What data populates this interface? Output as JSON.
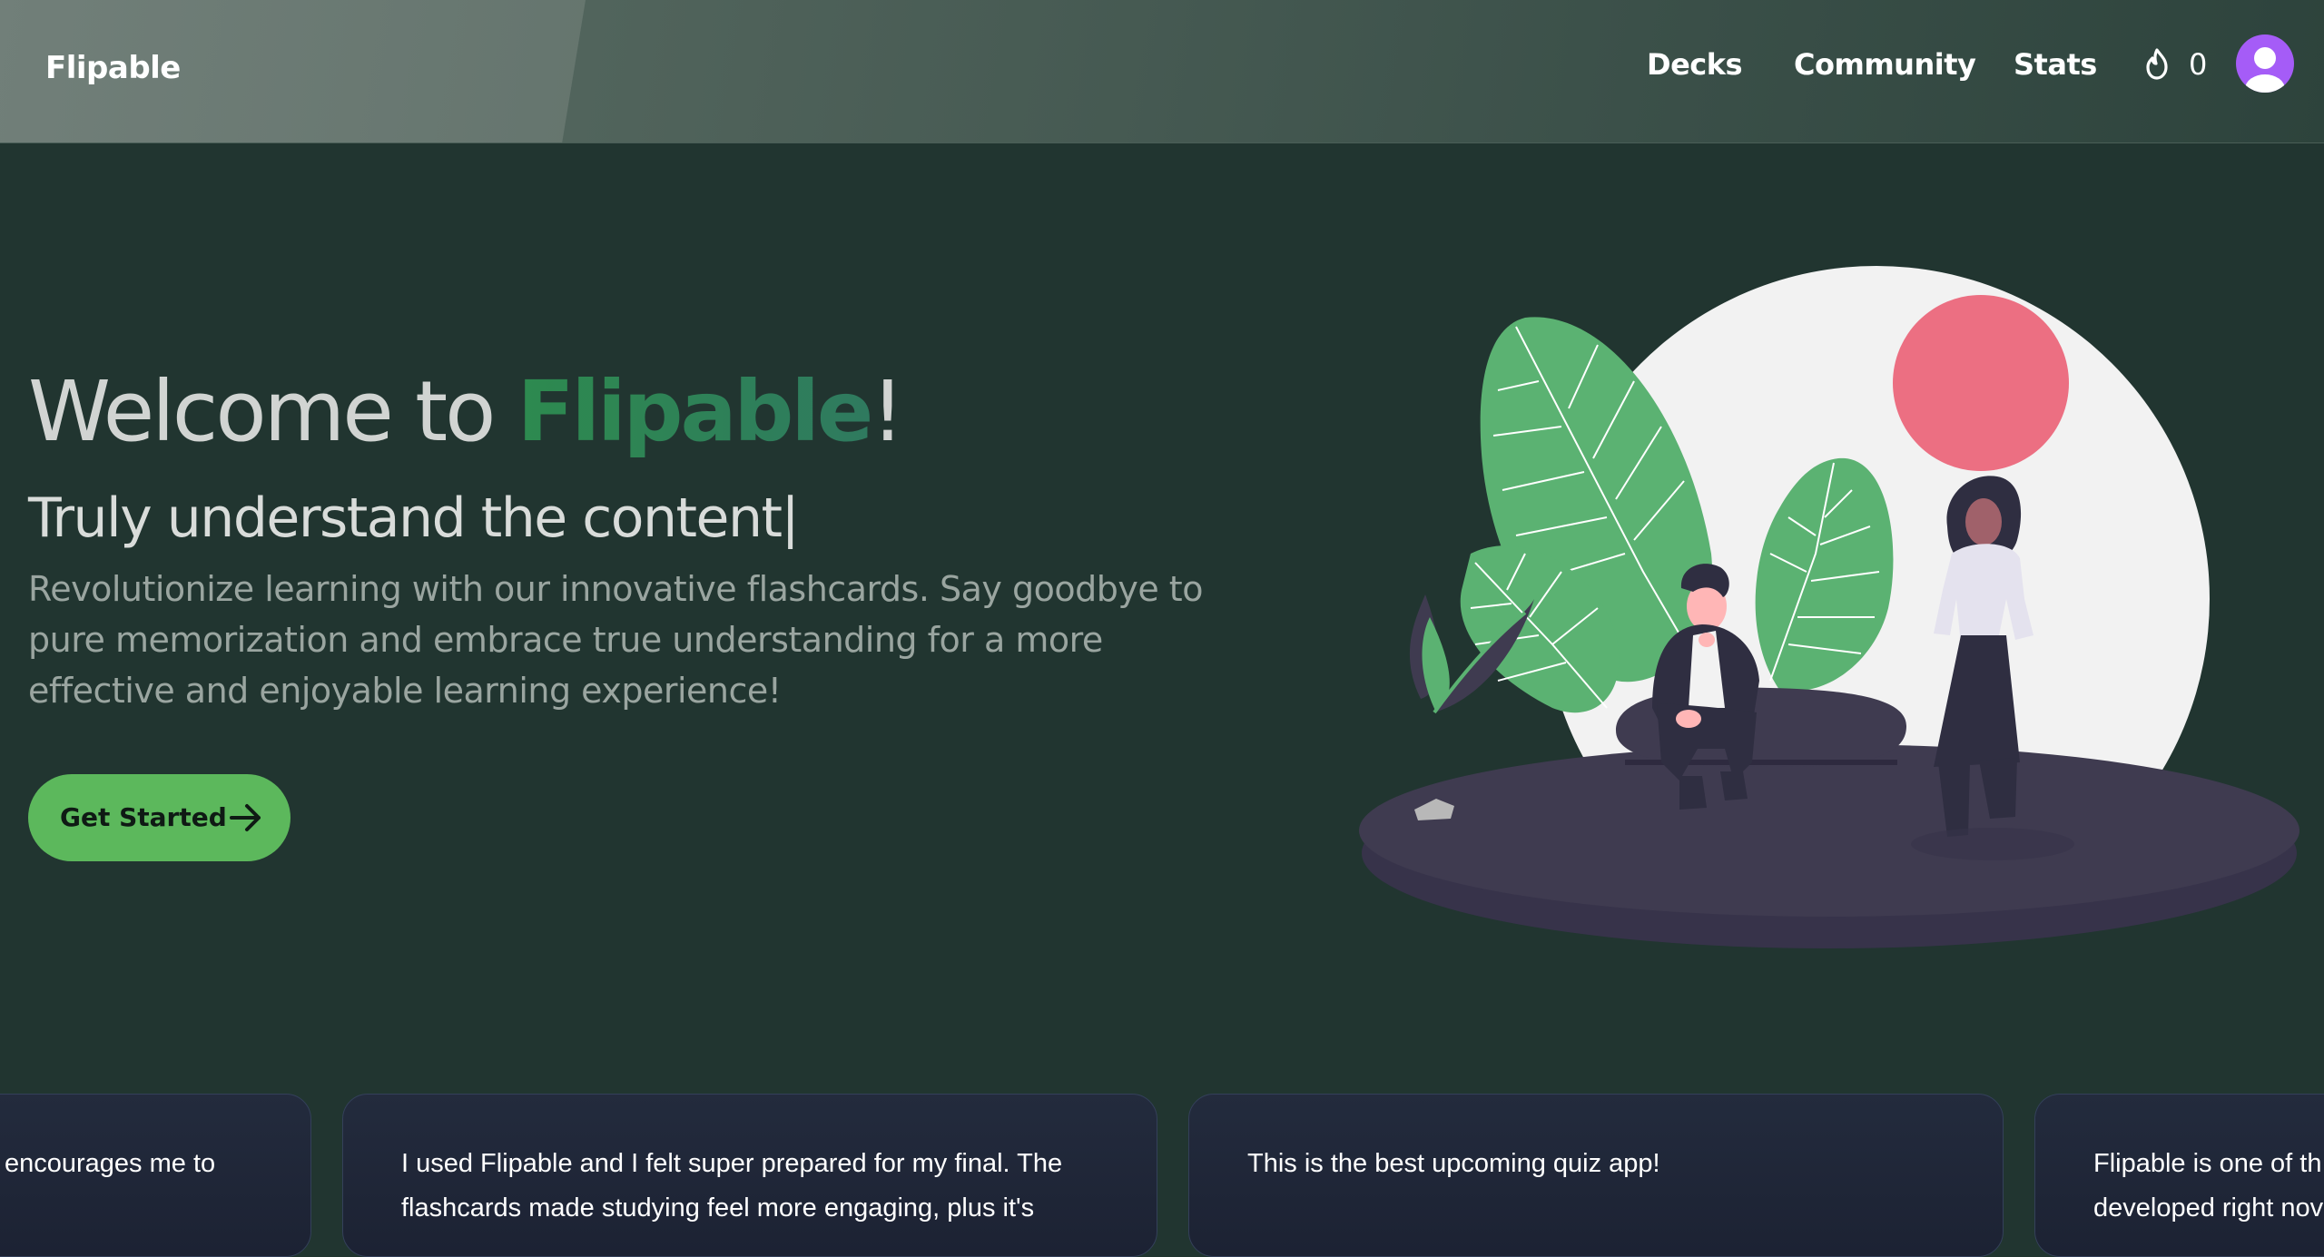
{
  "nav": {
    "brand": "Flipable",
    "links": [
      "Decks",
      "Community",
      "Stats"
    ],
    "streak_count": "0",
    "streak_icon": "flame-icon",
    "avatar_icon": "user-avatar-icon"
  },
  "hero": {
    "title_prefix": "Welcome to ",
    "title_brand": "Flipable",
    "title_suffix": "!",
    "subtitle": "Truly understand the content|",
    "description": "Revolutionize learning with our innovative flashcards. Say goodbye to pure memorization and embrace true understanding for a more effective and enjoyable learning experience!",
    "cta_label": "Get Started",
    "cta_icon": "arrow-right-icon"
  },
  "testimonials": [
    {
      "lines": [
        "encourages me to"
      ]
    },
    {
      "lines": [
        "I used Flipable and I felt super prepared for my final. The",
        "flashcards made studying feel more engaging, plus it's"
      ]
    },
    {
      "lines": [
        "This is the best upcoming quiz app!"
      ]
    },
    {
      "lines": [
        "Flipable is one of th",
        "developed right nov"
      ]
    }
  ],
  "colors": {
    "background": "#213530",
    "accent_green": "#5cb85c",
    "brand_text": "#2d8a4f",
    "avatar": "#a55cf7",
    "sun": "#ec6f82",
    "leaf": "#5bb272",
    "ground": "#3f3b50"
  }
}
